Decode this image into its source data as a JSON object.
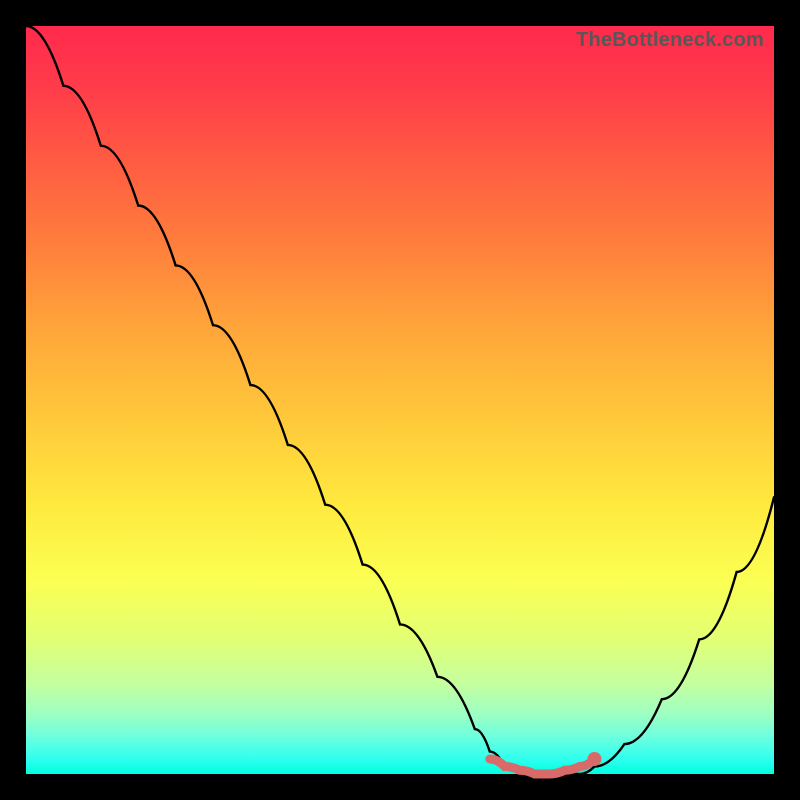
{
  "watermark": "TheBottleneck.com",
  "chart_data": {
    "type": "line",
    "title": "",
    "xlabel": "",
    "ylabel": "",
    "xlim": [
      0,
      100
    ],
    "ylim": [
      0,
      100
    ],
    "grid": false,
    "series": [
      {
        "name": "bottleneck-curve",
        "x": [
          0,
          5,
          10,
          15,
          20,
          25,
          30,
          35,
          40,
          45,
          50,
          55,
          60,
          62,
          64,
          66,
          68,
          70,
          72,
          74,
          76,
          80,
          85,
          90,
          95,
          100
        ],
        "values": [
          100,
          92,
          84,
          76,
          68,
          60,
          52,
          44,
          36,
          28,
          20,
          13,
          6,
          3,
          1,
          0,
          0,
          0,
          0,
          0,
          1,
          4,
          10,
          18,
          27,
          37
        ]
      },
      {
        "name": "bottleneck-floor-marker",
        "x": [
          62,
          64,
          66,
          68,
          70,
          72,
          74,
          76
        ],
        "values": [
          2,
          1,
          0.5,
          0,
          0,
          0.5,
          1,
          2
        ]
      }
    ],
    "annotations": [
      {
        "name": "min-dot",
        "x": 76,
        "y": 2
      }
    ],
    "colors": {
      "curve": "#000000",
      "marker": "#d96a6a",
      "gradient_top": "#ff2a4c",
      "gradient_bottom": "#00ffe0"
    }
  }
}
